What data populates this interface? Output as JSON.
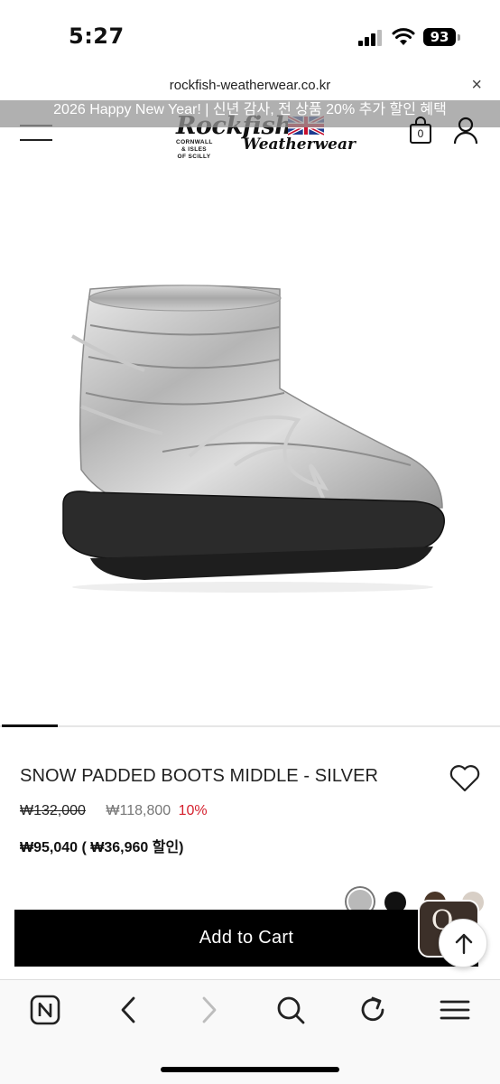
{
  "status_bar": {
    "time": "5:27",
    "battery_level": "93"
  },
  "browser": {
    "url": "rockfish-weatherwear.co.kr",
    "close_label": "×"
  },
  "promo": {
    "text": "2026 Happy New Year! | 신년 감사, 전 상품 20% 추가 할인 혜택"
  },
  "header": {
    "logo_main": "Rockfish",
    "logo_sub_left": "CORNWALL & ISLES OF SCILLY",
    "logo_sub_right": "Weatherwear",
    "cart_count": "0"
  },
  "product": {
    "title": "SNOW PADDED BOOTS MIDDLE - SILVER",
    "price_original": "₩132,000",
    "price_sale": "₩118,800",
    "discount_rate": "10%",
    "price_final": "₩95,040 ( ₩36,960 할인)",
    "image_progress": 0.11,
    "swatch_colors": [
      "#b9b9b9",
      "#111111",
      "#4a3628",
      "#d8cfc6"
    ]
  },
  "actions": {
    "add_to_cart_label": "Add to Cart",
    "q_badge_letter": "Q"
  },
  "icons": {
    "menu": "hamburger-menu-icon",
    "cart": "shopping-bag-icon",
    "user": "user-icon",
    "wish": "heart-icon",
    "scroll_top": "arrow-up-icon",
    "toolbar": [
      "naver-home-icon",
      "back-icon",
      "forward-icon",
      "search-icon",
      "reload-icon",
      "menu-icon"
    ]
  }
}
